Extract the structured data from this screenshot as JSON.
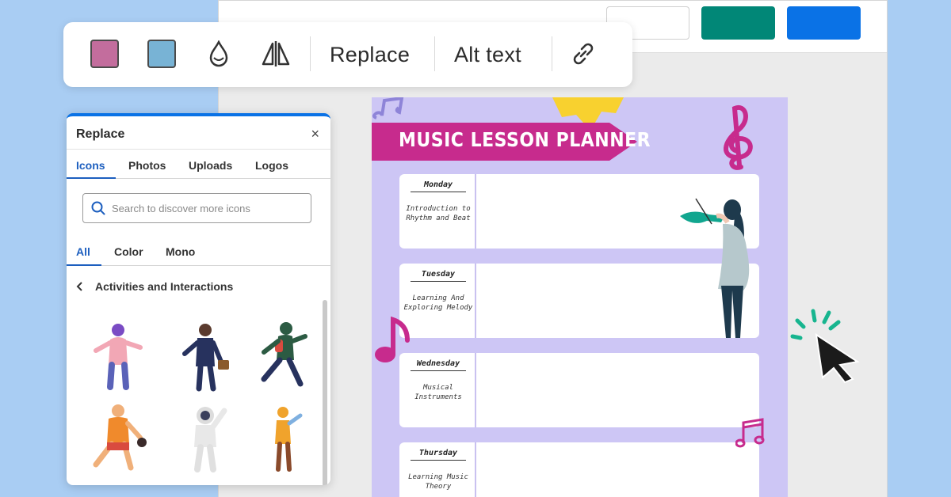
{
  "colors": {
    "swatch_1": "#c36d9d",
    "swatch_2": "#78b3d5",
    "accent_blue": "#0a72e6",
    "accent_teal": "#018777",
    "planner_bg": "#cdc6f5",
    "banner": "#c72b8d"
  },
  "toolbar": {
    "replace_label": "Replace",
    "alt_text_label": "Alt text",
    "icons": [
      "color-swatch",
      "color-swatch",
      "transparency-drop-icon",
      "flip-icon",
      "link-icon"
    ]
  },
  "panel": {
    "title": "Replace",
    "close_label": "×",
    "tabs": [
      {
        "label": "Icons",
        "active": true
      },
      {
        "label": "Photos",
        "active": false
      },
      {
        "label": "Uploads",
        "active": false
      },
      {
        "label": "Logos",
        "active": false
      }
    ],
    "search": {
      "placeholder": "Search to discover more icons"
    },
    "filters": [
      {
        "label": "All",
        "active": true
      },
      {
        "label": "Color",
        "active": false
      },
      {
        "label": "Mono",
        "active": false
      }
    ],
    "category": "Activities and Interactions"
  },
  "planner": {
    "title": "MUSIC LESSON PLANNER",
    "days": [
      {
        "name": "Monday",
        "topic": "Introduction to Rhythm and Beat"
      },
      {
        "name": "Tuesday",
        "topic": "Learning And Exploring Melody"
      },
      {
        "name": "Wednesday",
        "topic": "Musical Instruments"
      },
      {
        "name": "Thursday",
        "topic": "Learning Music Theory"
      }
    ]
  }
}
